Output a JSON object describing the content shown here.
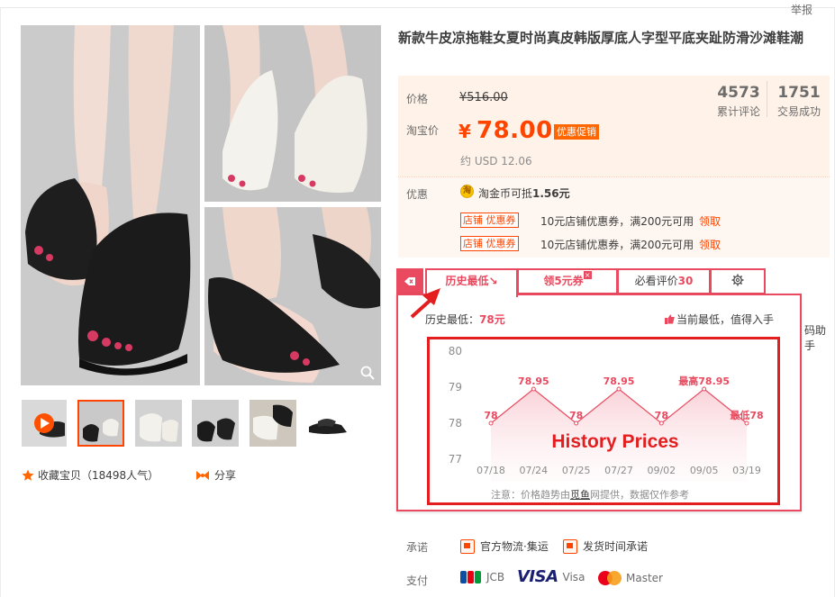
{
  "header": {
    "report_label": "举报"
  },
  "product": {
    "title": "新款牛皮凉拖鞋女夏时尚真皮韩版厚底人字型平底夹趾防滑沙滩鞋潮",
    "gallery": {
      "images": [
        {
          "desc": "black flip-flop sandals worn on feet",
          "shoe_color": "#222222"
        },
        {
          "desc": "white flip-flop sandals worn on feet",
          "shoe_color": "#f2f0ea"
        },
        {
          "desc": "black flip-flop sandal close-up",
          "shoe_color": "#222222"
        }
      ],
      "thumbnails_count": 6,
      "active_thumbnail": 1
    },
    "favorite_label": "收藏宝贝（18498人气）",
    "share_label": "分享"
  },
  "price": {
    "label": "价格",
    "original": "¥516.00",
    "taobao_label": "淘宝价",
    "currency": "¥",
    "current": "78.00",
    "promo_badge": "优惠促销",
    "usd": "约 USD 12.06",
    "reviews_count": "4573",
    "reviews_label": "累计评论",
    "sales_count": "1751",
    "sales_label": "交易成功"
  },
  "promotion": {
    "label": "优惠",
    "coin_icon_char": "淘",
    "coin_text_prefix": "淘金币可抵",
    "coin_amount": "1.56元",
    "coupons": [
      {
        "tag": "店铺 优惠券",
        "text": "10元店铺优惠券，满200元可用",
        "action": "领取"
      },
      {
        "tag": "店铺 优惠券",
        "text": "10元店铺优惠券，满200元可用",
        "action": "领取"
      }
    ]
  },
  "plugin": {
    "tabs": [
      {
        "label": "历史最低",
        "suffix": "↘"
      },
      {
        "label": "领5元券",
        "badge": "×"
      },
      {
        "label": "必看评价",
        "count": "30"
      }
    ],
    "history_low_label": "历史最低：",
    "history_low_value": "78元",
    "current_low_text": "当前最低，值得入手",
    "side_peek_text": "码助手",
    "note_prefix": "注意：价格趋势由",
    "note_link": "觅鱼",
    "note_suffix": "网提供，数据仅作参考"
  },
  "chart_data": {
    "type": "line",
    "title": "History Prices",
    "x": [
      "07/18",
      "07/24",
      "07/25",
      "07/27",
      "09/02",
      "09/05",
      "03/19"
    ],
    "series": [
      {
        "values": [
          78,
          78.95,
          78,
          78.95,
          78,
          78.95,
          78
        ]
      }
    ],
    "data_labels": [
      "78",
      "78.95",
      "78",
      "78.95",
      "78",
      "最高78.95",
      "最低78"
    ],
    "y_ticks": [
      "80",
      "79",
      "78",
      "77"
    ],
    "ylim": [
      77,
      80
    ],
    "grid": false,
    "line_color": "#e94a5f"
  },
  "service": {
    "label": "承诺",
    "items": [
      "官方物流·集运",
      "发货时间承诺"
    ]
  },
  "payment": {
    "label": "支付",
    "methods": [
      "JCB",
      "Visa",
      "Master"
    ],
    "visa_logo": "VISA"
  },
  "colors": {
    "accent": "#ff4400",
    "plugin_red": "#e94a5f",
    "price_bg": "#fff2e8"
  }
}
